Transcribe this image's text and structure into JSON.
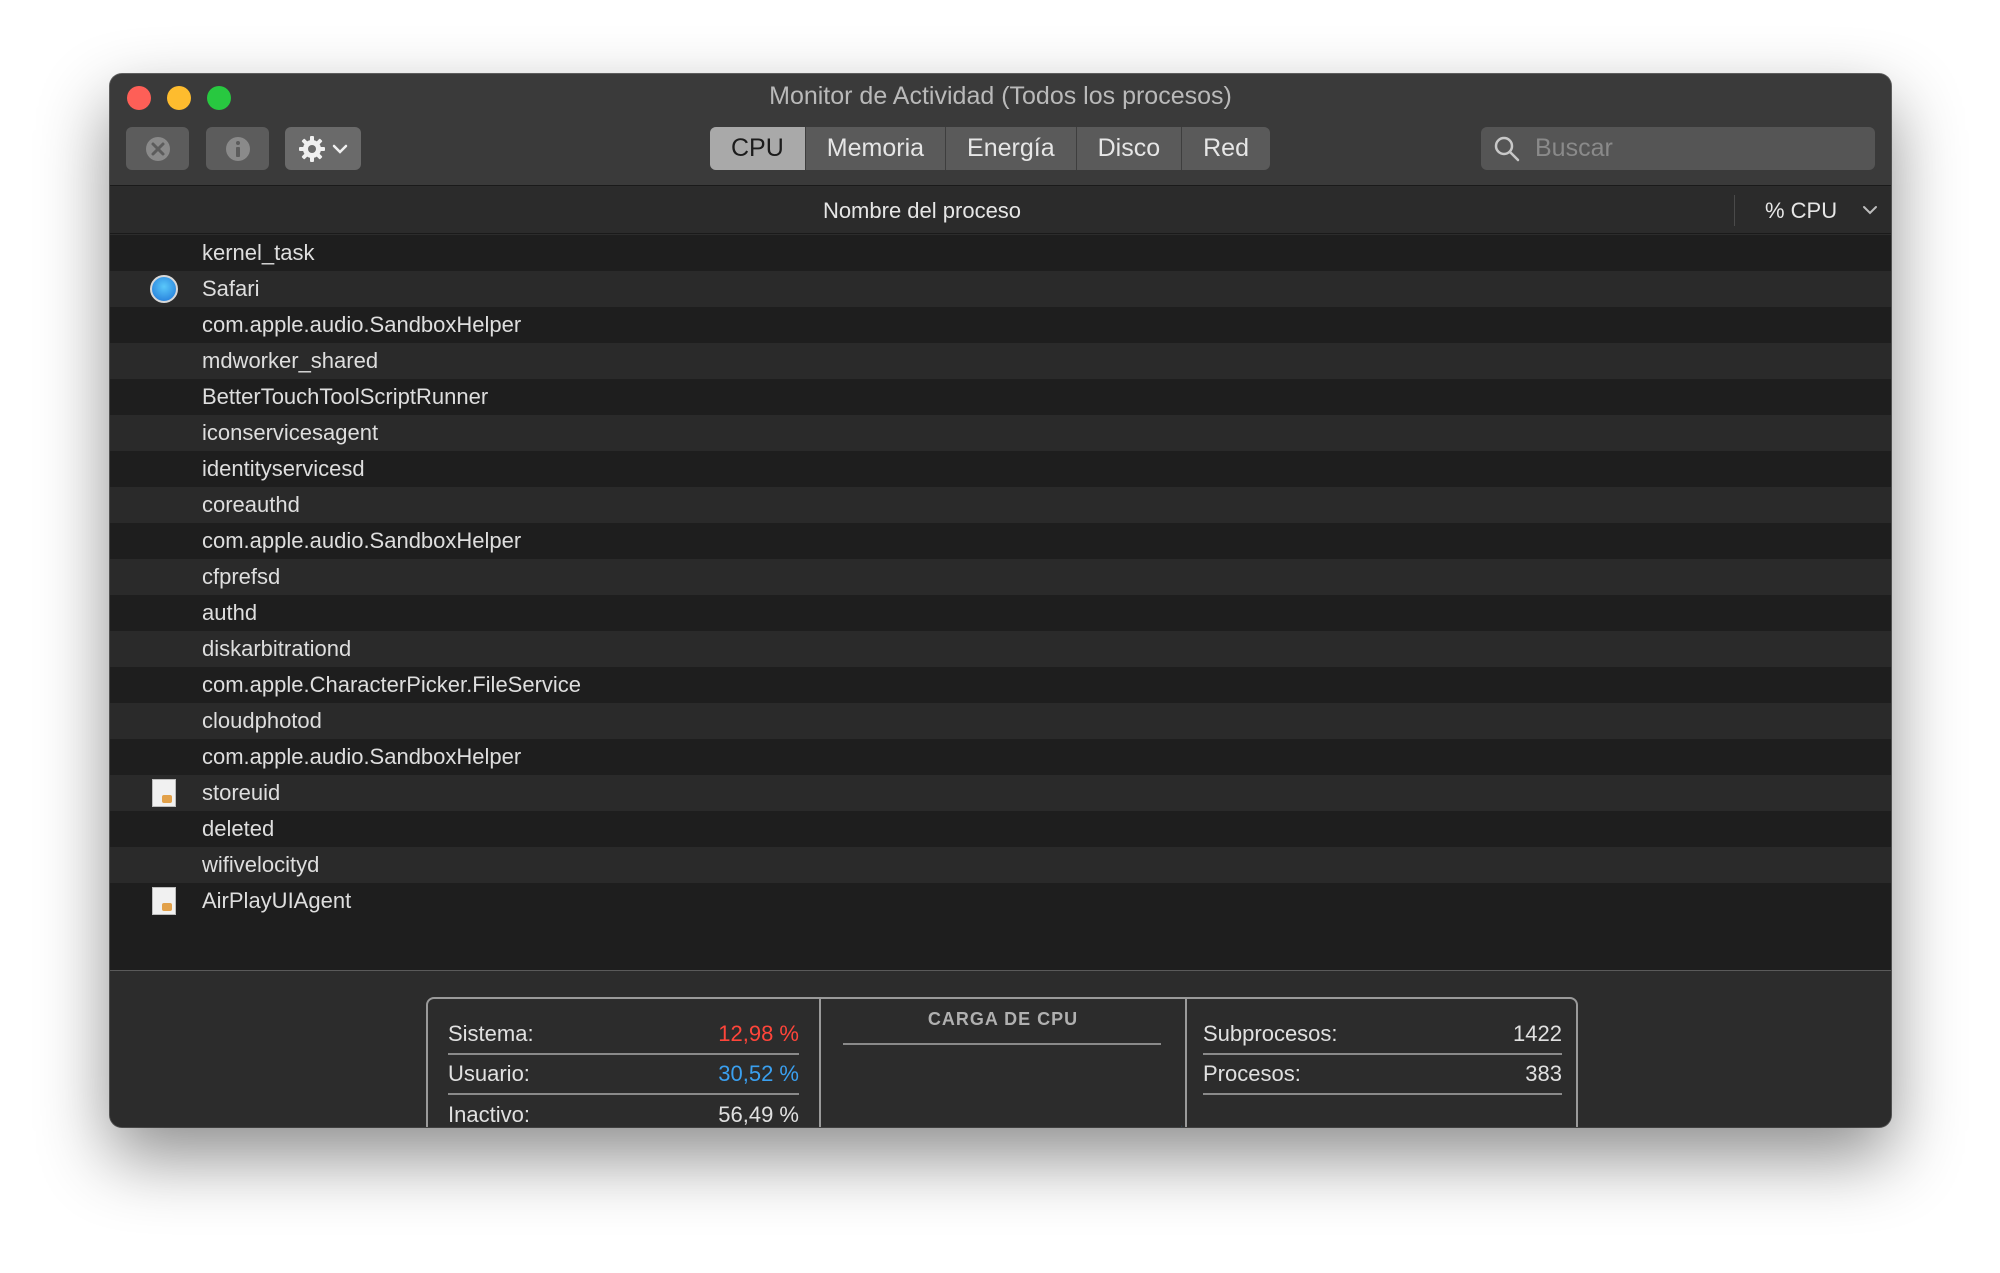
{
  "window": {
    "title": "Monitor de Actividad (Todos los procesos)"
  },
  "toolbar": {
    "stop_icon": "x-circle-icon",
    "info_icon": "info-icon",
    "gear_icon": "gear-icon",
    "tabs": [
      {
        "label": "CPU",
        "active": true
      },
      {
        "label": "Memoria",
        "active": false
      },
      {
        "label": "Energía",
        "active": false
      },
      {
        "label": "Disco",
        "active": false
      },
      {
        "label": "Red",
        "active": false
      }
    ],
    "search_placeholder": "Buscar"
  },
  "table": {
    "col_name": "Nombre del proceso",
    "col_cpu": "% CPU",
    "rows": [
      {
        "name": "kernel_task",
        "icon": ""
      },
      {
        "name": "Safari",
        "icon": "safari-icon"
      },
      {
        "name": "com.apple.audio.SandboxHelper",
        "icon": ""
      },
      {
        "name": "mdworker_shared",
        "icon": ""
      },
      {
        "name": "BetterTouchToolScriptRunner",
        "icon": ""
      },
      {
        "name": "iconservicesagent",
        "icon": ""
      },
      {
        "name": "identityservicesd",
        "icon": ""
      },
      {
        "name": "coreauthd",
        "icon": ""
      },
      {
        "name": "com.apple.audio.SandboxHelper",
        "icon": ""
      },
      {
        "name": "cfprefsd",
        "icon": ""
      },
      {
        "name": "authd",
        "icon": ""
      },
      {
        "name": "diskarbitrationd",
        "icon": ""
      },
      {
        "name": "com.apple.CharacterPicker.FileService",
        "icon": ""
      },
      {
        "name": "cloudphotod",
        "icon": ""
      },
      {
        "name": "com.apple.audio.SandboxHelper",
        "icon": ""
      },
      {
        "name": "storeuid",
        "icon": "document-icon"
      },
      {
        "name": "deleted",
        "icon": ""
      },
      {
        "name": "wifivelocityd",
        "icon": ""
      },
      {
        "name": "AirPlayUIAgent",
        "icon": "document-icon"
      }
    ]
  },
  "stats": {
    "sistema_label": "Sistema:",
    "sistema_value": "12,98 %",
    "usuario_label": "Usuario:",
    "usuario_value": "30,52 %",
    "inactivo_label": "Inactivo:",
    "inactivo_value": "56,49 %",
    "load_title": "CARGA DE CPU",
    "subprocesos_label": "Subprocesos:",
    "subprocesos_value": "1422",
    "procesos_label": "Procesos:",
    "procesos_value": "383"
  },
  "colors": {
    "system": "#ff453a",
    "user": "#3aa0f0"
  }
}
